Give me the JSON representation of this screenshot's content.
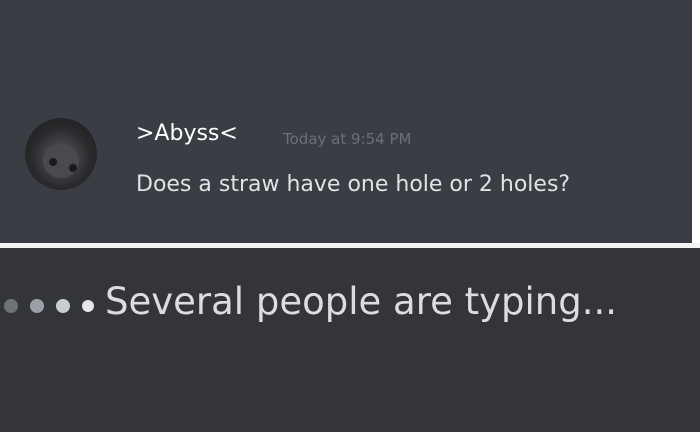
{
  "message": {
    "username": ">Abyss<",
    "timestamp": "Today at 9:54 PM",
    "text": "Does a straw have one hole or 2 holes?",
    "avatar_icon": "avatar-icon"
  },
  "typing_indicator": {
    "text": "Several people are typing...",
    "icon": "typing-dots-icon"
  },
  "colors": {
    "background": "#36393f",
    "username": "#ffffff",
    "timestamp": "#6c6f75",
    "message_text": "#e1e2e4",
    "typing_text": "#dcdddf"
  }
}
